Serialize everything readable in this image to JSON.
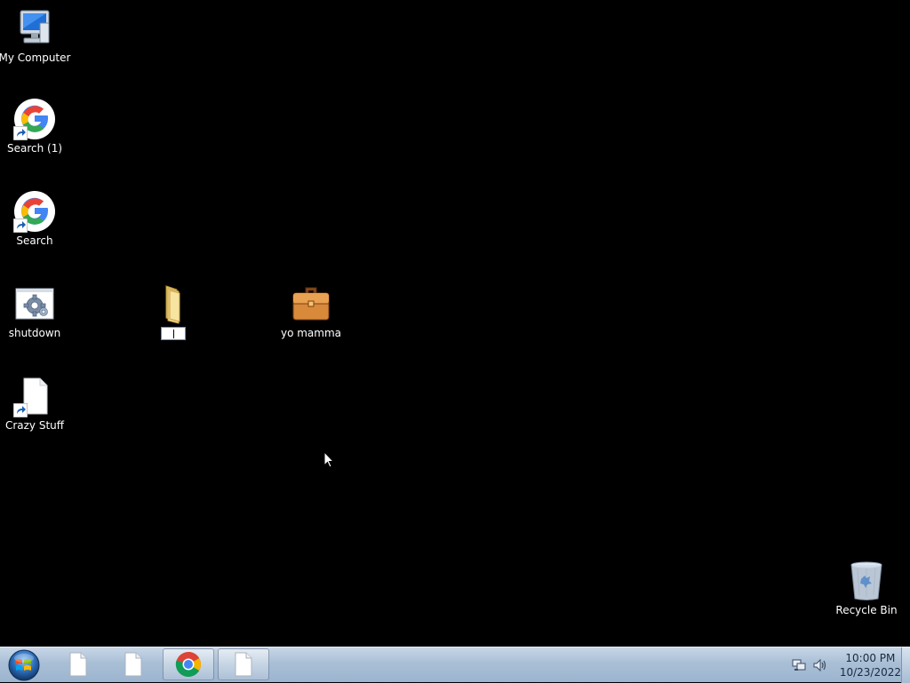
{
  "desktop": {
    "icons": [
      {
        "label": "My Computer",
        "icon": "computer-icon"
      },
      {
        "label": "Search (1)",
        "icon": "google-icon",
        "shortcut": true
      },
      {
        "label": "Search",
        "icon": "google-icon",
        "shortcut": true
      },
      {
        "label": "shutdown",
        "icon": "settings-shortcut-icon"
      },
      {
        "label": "Crazy Stuff",
        "icon": "document-icon",
        "shortcut": true
      },
      {
        "label": "",
        "icon": "folder-icon",
        "renaming": true
      },
      {
        "label": "yo mamma",
        "icon": "briefcase-icon"
      },
      {
        "label": "Recycle Bin",
        "icon": "recycle-bin-icon"
      }
    ]
  },
  "taskbar": {
    "start": {
      "icon": "windows-start-icon"
    },
    "buttons": [
      {
        "icon": "document-icon",
        "active": false
      },
      {
        "icon": "document-icon",
        "active": false
      },
      {
        "icon": "chrome-icon",
        "active": true
      },
      {
        "icon": "document-icon",
        "active": true
      }
    ],
    "tray": {
      "icons": [
        "network-icon",
        "volume-icon"
      ],
      "time": "10:00 PM",
      "date": "10/23/2022"
    }
  },
  "colors": {
    "desktop_background": "#000000",
    "taskbar": "#a9bfd6",
    "label_text": "#ffffff"
  }
}
